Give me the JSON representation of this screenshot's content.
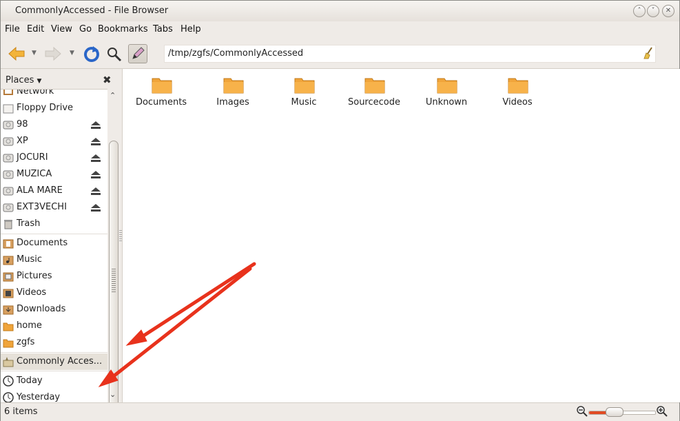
{
  "window": {
    "title": "CommonlyAccessed - File Browser",
    "controls": [
      "minimize",
      "maximize",
      "close"
    ]
  },
  "menubar": {
    "items": [
      {
        "label": "File",
        "mnemonic": "F"
      },
      {
        "label": "Edit",
        "mnemonic": "E"
      },
      {
        "label": "View",
        "mnemonic": "V"
      },
      {
        "label": "Go",
        "mnemonic": "G"
      },
      {
        "label": "Bookmarks",
        "mnemonic": "B"
      },
      {
        "label": "Tabs",
        "mnemonic": "T"
      },
      {
        "label": "Help",
        "mnemonic": "H"
      }
    ]
  },
  "toolbar": {
    "back_icon": "back-arrow-icon",
    "forward_icon": "forward-arrow-icon",
    "reload_icon": "reload-icon",
    "search_icon": "search-icon",
    "edit_location_icon": "pencil-icon"
  },
  "location": {
    "path": "/tmp/zgfs/CommonlyAccessed",
    "clear_icon": "broom-icon"
  },
  "sidebar": {
    "header": "Places",
    "header_arrow": "▼",
    "close_icon": "close-icon",
    "items": [
      {
        "label": "Network",
        "icon": "network-icon",
        "eject": false
      },
      {
        "label": "Floppy Drive",
        "icon": "floppy-icon",
        "eject": false
      },
      {
        "label": "98",
        "icon": "drive-icon",
        "eject": true
      },
      {
        "label": "XP",
        "icon": "drive-icon",
        "eject": true
      },
      {
        "label": "JOCURI",
        "icon": "drive-icon",
        "eject": true
      },
      {
        "label": "MUZICA",
        "icon": "drive-icon",
        "eject": true
      },
      {
        "label": "ALA MARE",
        "icon": "drive-icon",
        "eject": true
      },
      {
        "label": "EXT3VECHI",
        "icon": "drive-icon",
        "eject": true
      },
      {
        "label": "Trash",
        "icon": "trash-icon",
        "eject": false
      },
      {
        "label": "Documents",
        "icon": "documents-folder-icon",
        "eject": false
      },
      {
        "label": "Music",
        "icon": "music-folder-icon",
        "eject": false
      },
      {
        "label": "Pictures",
        "icon": "pictures-folder-icon",
        "eject": false
      },
      {
        "label": "Videos",
        "icon": "videos-folder-icon",
        "eject": false
      },
      {
        "label": "Downloads",
        "icon": "downloads-folder-icon",
        "eject": false
      },
      {
        "label": "home",
        "icon": "folder-icon",
        "eject": false
      },
      {
        "label": "zgfs",
        "icon": "folder-icon",
        "eject": false
      },
      {
        "label": "Commonly Acces...",
        "icon": "commonly-accessed-icon",
        "eject": false,
        "selected": true
      },
      {
        "label": "Today",
        "icon": "clock-icon",
        "eject": false
      },
      {
        "label": "Yesterday",
        "icon": "clock-icon",
        "eject": false
      }
    ]
  },
  "files": [
    {
      "name": "Documents",
      "icon": "folder-icon"
    },
    {
      "name": "Images",
      "icon": "folder-icon"
    },
    {
      "name": "Music",
      "icon": "folder-icon"
    },
    {
      "name": "Sourcecode",
      "icon": "folder-icon"
    },
    {
      "name": "Unknown",
      "icon": "folder-icon"
    },
    {
      "name": "Videos",
      "icon": "folder-icon"
    }
  ],
  "status": {
    "text": "6 items",
    "zoom_level": 0.3,
    "zoom_out_icon": "zoom-out-icon",
    "zoom_in_icon": "zoom-in-icon"
  },
  "annotations": {
    "arrows": 2,
    "arrow_color": "#e8321c"
  },
  "colors": {
    "folder": "#f0a43a",
    "selection": "#e6e1d9",
    "window_bg": "#efebe7"
  }
}
